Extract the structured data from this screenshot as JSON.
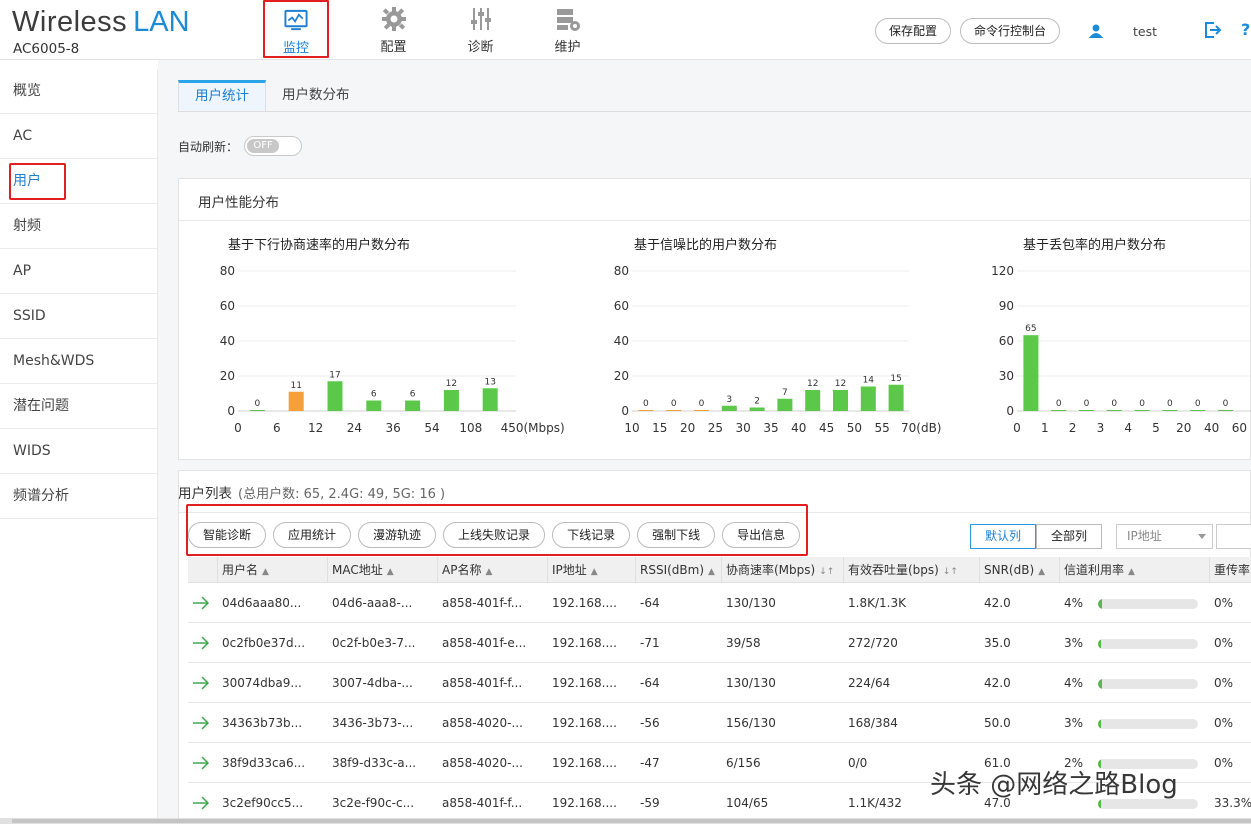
{
  "header": {
    "brand_part1": "Wireless",
    "brand_part2": "LAN",
    "model": "AC6005-8",
    "nav": [
      {
        "label": "监控",
        "icon": "monitor-icon",
        "active": true
      },
      {
        "label": "配置",
        "icon": "gear-icon"
      },
      {
        "label": "诊断",
        "icon": "sliders-icon"
      },
      {
        "label": "维护",
        "icon": "maintenance-icon"
      }
    ],
    "save_config": "保存配置",
    "cli_console": "命令行控制台",
    "username": "test"
  },
  "sidebar": {
    "items": [
      {
        "label": "概览"
      },
      {
        "label": "AC"
      },
      {
        "label": "用户",
        "active": true
      },
      {
        "label": "射频"
      },
      {
        "label": "AP"
      },
      {
        "label": "SSID"
      },
      {
        "label": "Mesh&WDS"
      },
      {
        "label": "潜在问题"
      },
      {
        "label": "WIDS"
      },
      {
        "label": "频谱分析"
      }
    ]
  },
  "tabs": [
    {
      "label": "用户统计",
      "active": true
    },
    {
      "label": "用户数分布"
    }
  ],
  "auto_refresh": {
    "label": "自动刷新：",
    "state": "OFF"
  },
  "perf_panel": {
    "title": "用户性能分布"
  },
  "chart_data": [
    {
      "type": "bar",
      "title": "基于下行协商速率的用户数分布",
      "categories": [
        "0",
        "6",
        "12",
        "24",
        "36",
        "54",
        "108",
        "450"
      ],
      "x_unit": "(Mbps)",
      "values": [
        0,
        11,
        17,
        6,
        6,
        12,
        13
      ],
      "highlight_index": 1,
      "ylim": [
        0,
        80
      ],
      "yticks": [
        0,
        20,
        40,
        60,
        80
      ]
    },
    {
      "type": "bar",
      "title": "基于信噪比的用户数分布",
      "categories": [
        "10",
        "15",
        "20",
        "25",
        "30",
        "35",
        "40",
        "45",
        "50",
        "55",
        "70"
      ],
      "x_unit": "(dB)",
      "values": [
        0,
        0,
        0,
        3,
        2,
        7,
        12,
        12,
        14,
        15
      ],
      "ylim": [
        0,
        80
      ],
      "yticks": [
        0,
        20,
        40,
        60,
        80
      ]
    },
    {
      "type": "bar",
      "title": "基于丢包率的用户数分布",
      "categories": [
        "0",
        "1",
        "2",
        "3",
        "4",
        "5",
        "20",
        "40",
        "60"
      ],
      "x_unit": "",
      "values": [
        65,
        0,
        0,
        0,
        0,
        0,
        0,
        0
      ],
      "ylim": [
        0,
        120
      ],
      "yticks": [
        0,
        30,
        60,
        90,
        120
      ]
    }
  ],
  "user_list": {
    "title": "用户列表",
    "summary": "(总用户数: 65,  2.4G: 49,  5G: 16 )",
    "actions": [
      "智能诊断",
      "应用统计",
      "漫游轨迹",
      "上线失败记录",
      "下线记录",
      "强制下线",
      "导出信息"
    ],
    "default_cols": "默认列",
    "all_cols": "全部列",
    "filter_field": "IP地址",
    "columns": [
      "用户名",
      "MAC地址",
      "AP名称",
      "IP地址",
      "RSSI(dBm)",
      "协商速率(Mbps)",
      "有效吞吐量(bps)",
      "SNR(dB)",
      "信道利用率",
      "重传率"
    ],
    "rows": [
      {
        "user": "04d6aaa80...",
        "mac": "04d6-aaa8-...",
        "ap": "a858-401f-f...",
        "ip": "192.168....",
        "rssi": "-64",
        "rate": "130/130",
        "tput": "1.8K/1.3K",
        "snr": "42.0",
        "util": "4%",
        "util_frac": 0.04,
        "retry": "0%"
      },
      {
        "user": "0c2fb0e37d...",
        "mac": "0c2f-b0e3-7...",
        "ap": "a858-401f-e...",
        "ip": "192.168....",
        "rssi": "-71",
        "rate": "39/58",
        "tput": "272/720",
        "snr": "35.0",
        "util": "3%",
        "util_frac": 0.03,
        "retry": "0%"
      },
      {
        "user": "30074dba9...",
        "mac": "3007-4dba-...",
        "ap": "a858-401f-f...",
        "ip": "192.168....",
        "rssi": "-64",
        "rate": "130/130",
        "tput": "224/64",
        "snr": "42.0",
        "util": "4%",
        "util_frac": 0.04,
        "retry": "0%"
      },
      {
        "user": "34363b73b...",
        "mac": "3436-3b73-...",
        "ap": "a858-4020-...",
        "ip": "192.168....",
        "rssi": "-56",
        "rate": "156/130",
        "tput": "168/384",
        "snr": "50.0",
        "util": "3%",
        "util_frac": 0.03,
        "retry": "0%"
      },
      {
        "user": "38f9d33ca6...",
        "mac": "38f9-d33c-a...",
        "ap": "a858-4020-...",
        "ip": "192.168....",
        "rssi": "-47",
        "rate": "6/156",
        "tput": "0/0",
        "snr": "61.0",
        "util": "2%",
        "util_frac": 0.02,
        "retry": "0%"
      },
      {
        "user": "3c2ef90cc5...",
        "mac": "3c2e-f90c-c...",
        "ap": "a858-401f-f...",
        "ip": "192.168....",
        "rssi": "-59",
        "rate": "104/65",
        "tput": "1.1K/432",
        "snr": "47.0",
        "util": "",
        "util_frac": 0.03,
        "retry": "33.3%"
      }
    ]
  },
  "watermark": "头条 @网络之路Blog",
  "colors": {
    "accent": "#1c7fd1",
    "bar_green": "#5cc84a",
    "bar_orange": "#f5a03a",
    "highlight_red": "#e02020"
  }
}
